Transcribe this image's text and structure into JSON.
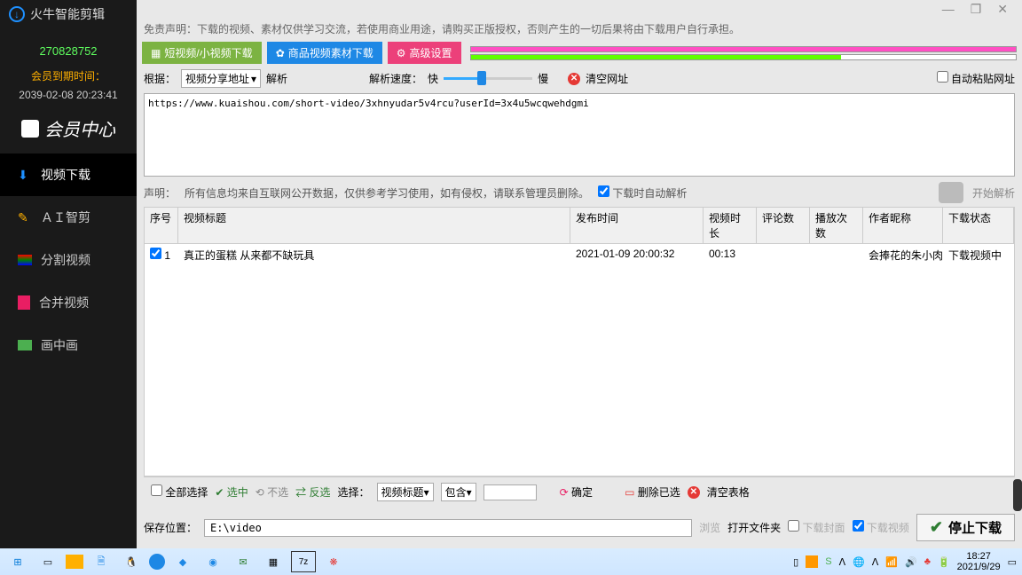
{
  "app": {
    "title": "火牛智能剪辑"
  },
  "sidebar": {
    "user_id": "270828752",
    "expire_label": "会员到期时间：",
    "expire_time": "2039-02-08 20:23:41",
    "member_center": "会员中心",
    "nav": [
      {
        "label": "视频下载",
        "icon": "download-icon"
      },
      {
        "label": "ＡＩ智剪",
        "icon": "ai-icon"
      },
      {
        "label": "分割视频",
        "icon": "split-icon"
      },
      {
        "label": "合并视频",
        "icon": "merge-icon"
      },
      {
        "label": "画中画",
        "icon": "pip-icon"
      }
    ]
  },
  "window": {
    "min": "—",
    "max": "❐",
    "close": "✕"
  },
  "disclaimer": "免责声明：下载的视频、素材仅供学习交流，若使用商业用途，请购买正版授权，否则产生的一切后果将由下载用户自行承担。",
  "tabs": {
    "t1": "短视频/小视频下载",
    "t2": "商品视频素材下载",
    "t3": "高级设置"
  },
  "progress": {
    "pink_pct": 100,
    "green_pct": 68
  },
  "controls": {
    "root_label": "根据：",
    "root_select": "视频分享地址",
    "parse_btn": "解析",
    "speed_label": "解析速度：",
    "fast": "快",
    "slow": "慢",
    "clear_url": "清空网址",
    "auto_paste": "自动粘贴网址"
  },
  "url_text": "https://www.kuaishou.com/short-video/3xhnyudar5v4rcu?userId=3x4u5wcqwehdgmi",
  "info": {
    "notice_label": "声明：",
    "notice": "所有信息均来自互联网公开数据，仅供参考学习使用，如有侵权，请联系管理员删除。",
    "auto_parse": "下载时自动解析",
    "start_parse": "开始解析"
  },
  "table": {
    "headers": {
      "idx": "序号",
      "title": "视频标题",
      "pub": "发布时间",
      "dur": "视频时长",
      "cmt": "评论数",
      "play": "播放次数",
      "auth": "作者昵称",
      "stat": "下载状态"
    },
    "rows": [
      {
        "idx": "1",
        "title": "真正的蛋糕  从来都不缺玩具",
        "pub": "2021-01-09 20:00:32",
        "dur": "00:13",
        "cmt": "",
        "play": "",
        "auth": "会捧花的朱小肉…",
        "stat": "下载视频中"
      }
    ]
  },
  "filter": {
    "select_all": "全部选择",
    "sel": "选中",
    "unsel": "不选",
    "inv": "反选",
    "pick_label": "选择：",
    "pick_field": "视频标题",
    "contain": "包含",
    "ok": "确定",
    "del": "删除已选",
    "clear": "清空表格"
  },
  "save": {
    "label": "保存位置：",
    "path": "E:\\video",
    "browse": "浏览",
    "open": "打开文件夹",
    "dl_cover": "下载封面",
    "dl_video": "下载视频",
    "stop": "停止下载"
  },
  "taskbar": {
    "time": "18:27",
    "date": "2021/9/29"
  }
}
